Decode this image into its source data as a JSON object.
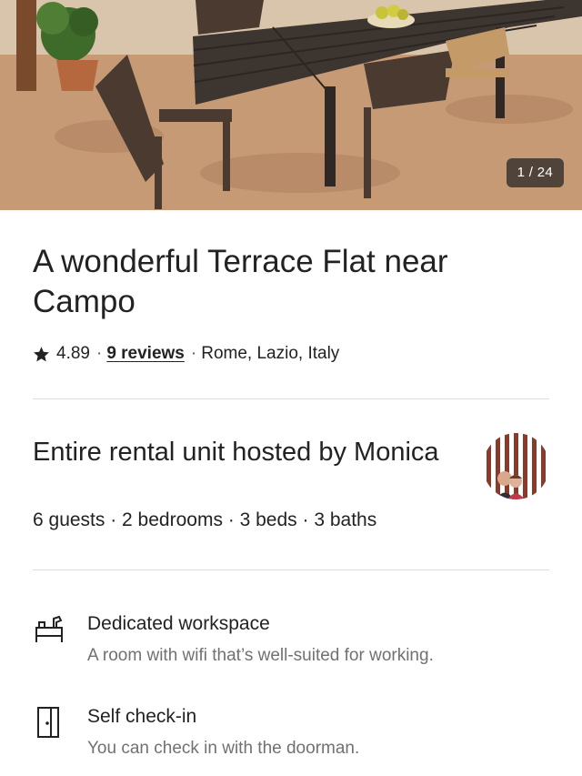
{
  "gallery": {
    "counter": "1 / 24"
  },
  "listing": {
    "title": "A wonderful Terrace Flat near Campo",
    "rating": "4.89",
    "separator": "·",
    "reviews_label": "9 reviews",
    "location": "Rome, Lazio, Italy"
  },
  "host": {
    "heading": "Entire rental unit hosted by Monica",
    "details": "6 guests · 2 bedrooms · 3 beds · 3 baths"
  },
  "features": [
    {
      "icon": "workspace-desk-icon",
      "title": "Dedicated workspace",
      "description": "A room with wifi that’s well-suited for working."
    },
    {
      "icon": "door-icon",
      "title": "Self check-in",
      "description": "You can check in with the doorman."
    }
  ]
}
